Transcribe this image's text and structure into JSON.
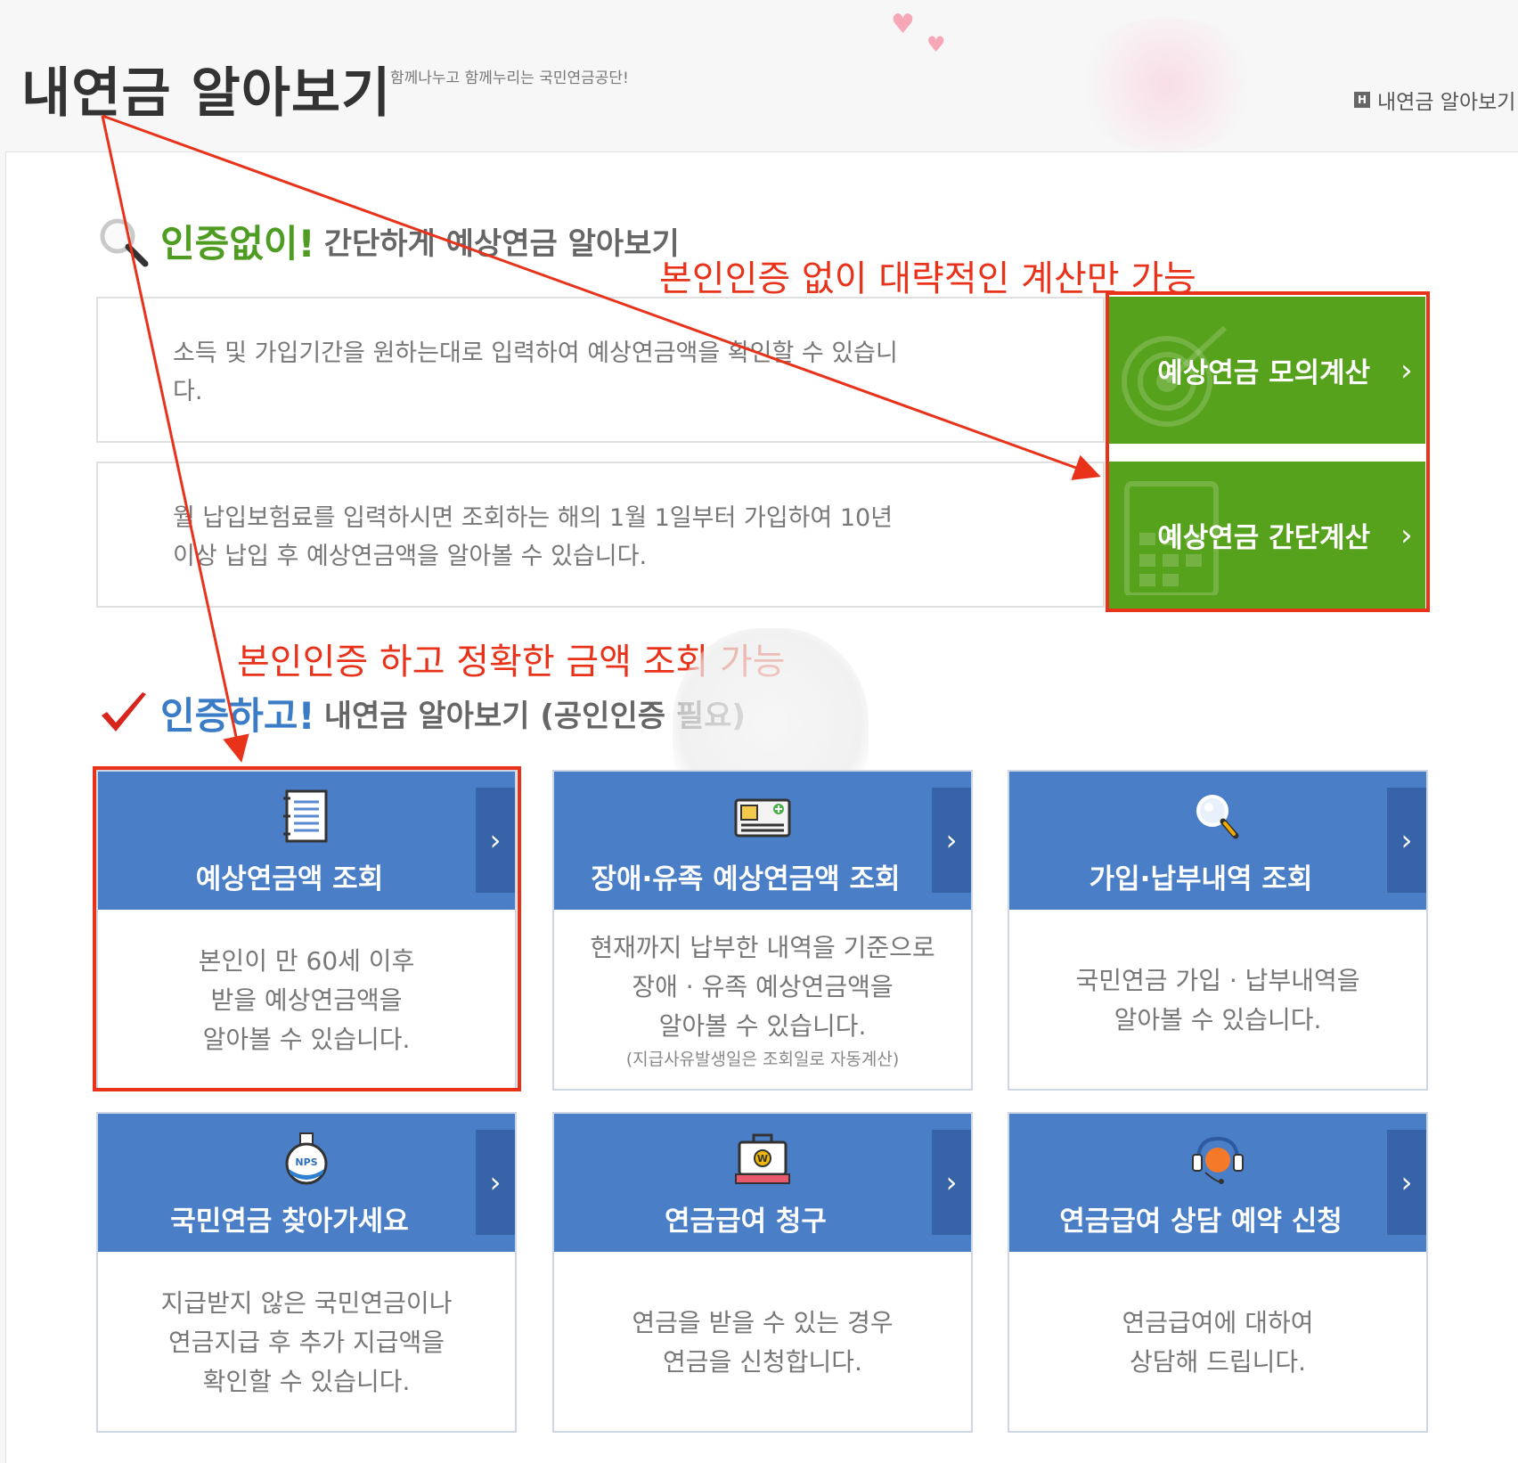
{
  "header": {
    "title": "내연금 알아보기",
    "subtitle": "함께나누고 함께누리는 국민연금공단!",
    "breadcrumb": "내연금 알아보기",
    "breadcrumb_icon": "H"
  },
  "section1": {
    "title_em": "인증없이!",
    "title_rest": "간단하게 예상연금 알아보기",
    "rows": [
      {
        "text": "소득 및 가입기간을 원하는대로 입력하여 예상연금액을 확인할 수 있습니다.",
        "button": "예상연금 모의계산",
        "button_icon": "target-icon"
      },
      {
        "text": "월 납입보험료를 입력하시면 조회하는 해의 1월 1일부터 가입하여 10년 이상 납입 후 예상연금액을 알아볼 수 있습니다.",
        "button": "예상연금 간단계산",
        "button_icon": "calculator-icon"
      }
    ]
  },
  "section2": {
    "title_em": "인증하고!",
    "title_rest": "내연금 알아보기 (공인인증 필요)",
    "cards": [
      {
        "title": "예상연금액 조회",
        "lines": [
          "본인이 만 60세 이후",
          "받을 예상연금액을",
          "알아볼 수 있습니다."
        ],
        "note": "",
        "icon": "document-icon"
      },
      {
        "title": "장애·유족 예상연금액 조회",
        "lines": [
          "현재까지 납부한 내역을 기준으로",
          "장애 · 유족 예상연금액을",
          "알아볼 수 있습니다."
        ],
        "note": "(지급사유발생일은 조회일로 자동계산)",
        "icon": "id-card-icon"
      },
      {
        "title": "가입·납부내역 조회",
        "lines": [
          "국민연금 가입 · 납부내역을",
          "알아볼 수 있습니다."
        ],
        "note": "",
        "icon": "magnifier-icon"
      },
      {
        "title": "국민연금 찾아가세요",
        "lines": [
          "지급받지 않은 국민연금이나",
          "연금지급 후 추가 지급액을",
          "확인할 수 있습니다."
        ],
        "note": "",
        "icon": "nps-bottle-icon"
      },
      {
        "title": "연금급여 청구",
        "lines": [
          "연금을 받을 수 있는 경우",
          "연금을 신청합니다."
        ],
        "note": "",
        "icon": "won-register-icon"
      },
      {
        "title": "연금급여 상담 예약 신청",
        "lines": [
          "연금급여에 대하여",
          "상담해 드립니다."
        ],
        "note": "",
        "icon": "headset-icon"
      }
    ]
  },
  "annotations": {
    "no_auth": "본인인증 없이 대략적인 계산만 가능",
    "with_auth": "본인인증 하고 정확한 금액 조회 가능"
  },
  "colors": {
    "green": "#56a21c",
    "blue": "#4a7fc7",
    "blue_dark": "#3764a8",
    "annotation_red": "#e8321a"
  }
}
